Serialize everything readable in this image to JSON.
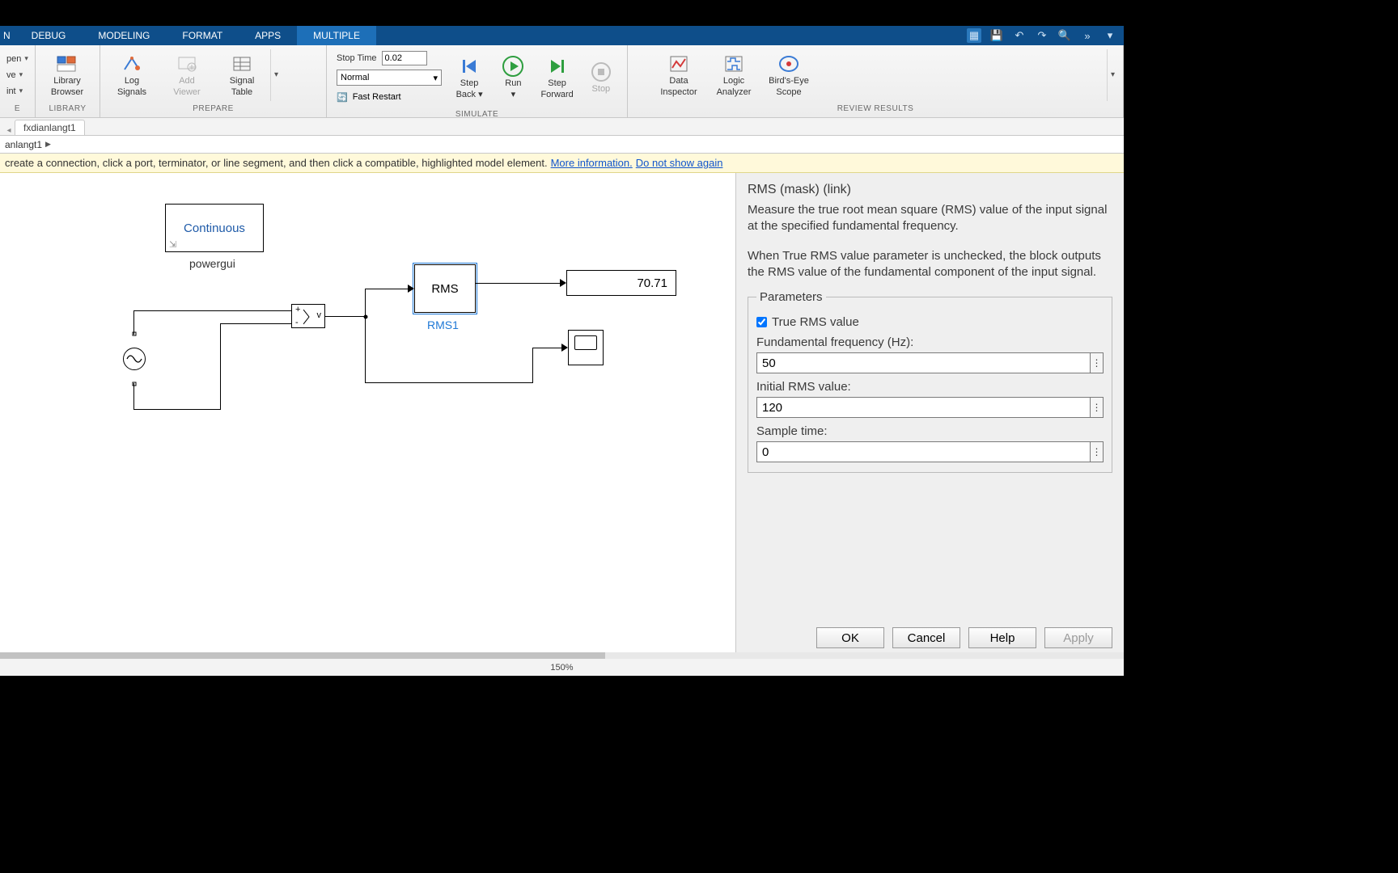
{
  "ribbon": {
    "tabs": [
      "N",
      "DEBUG",
      "MODELING",
      "FORMAT",
      "APPS",
      "MULTIPLE"
    ],
    "active": "MULTIPLE",
    "left_menu": {
      "items": [
        "pen",
        "ve",
        "int"
      ]
    },
    "library": {
      "label1": "Library",
      "label2": "Browser",
      "group": "LIBRARY"
    },
    "prepare": {
      "log1": "Log",
      "log2": "Signals",
      "add1": "Add",
      "add2": "Viewer",
      "sig1": "Signal",
      "sig2": "Table",
      "group": "PREPARE"
    },
    "simulate": {
      "stop_label": "Stop Time",
      "stop_value": "0.02",
      "mode": "Normal",
      "fast": "Fast Restart",
      "step_back1": "Step",
      "step_back2": "Back",
      "run": "Run",
      "step_fwd1": "Step",
      "step_fwd2": "Forward",
      "stop": "Stop",
      "group": "SIMULATE"
    },
    "review": {
      "di1": "Data",
      "di2": "Inspector",
      "la1": "Logic",
      "la2": "Analyzer",
      "be1": "Bird's-Eye",
      "be2": "Scope",
      "group": "REVIEW RESULTS"
    }
  },
  "filetab": "fxdianlangt1",
  "breadcrumb": "anlangt1",
  "infobar": {
    "text": "create a connection, click a port, terminator, or line segment, and then click a compatible, highlighted model element. ",
    "more": "More information.",
    "dismiss": "Do not show again"
  },
  "diagram": {
    "powergui_label": "Continuous",
    "powergui_name": "powergui",
    "rms_label": "RMS",
    "rms_name": "RMS1",
    "display_value": "70.71",
    "vm_plus": "+",
    "vm_minus": "-",
    "vm_v": "v"
  },
  "panel": {
    "title": "RMS (mask) (link)",
    "desc1": "Measure the true root mean square (RMS) value of the input signal at the specified fundamental frequency.",
    "desc2": "When True RMS value parameter is unchecked, the block outputs the RMS value of the fundamental component of the input signal.",
    "legend": "Parameters",
    "true_rms": "True RMS value",
    "freq_label": "Fundamental frequency (Hz):",
    "freq_value": "50",
    "init_label": "Initial RMS value:",
    "init_value": "120",
    "st_label": "Sample time:",
    "st_value": "0",
    "ok": "OK",
    "cancel": "Cancel",
    "help": "Help",
    "apply": "Apply"
  },
  "status": {
    "zoom": "150%"
  }
}
